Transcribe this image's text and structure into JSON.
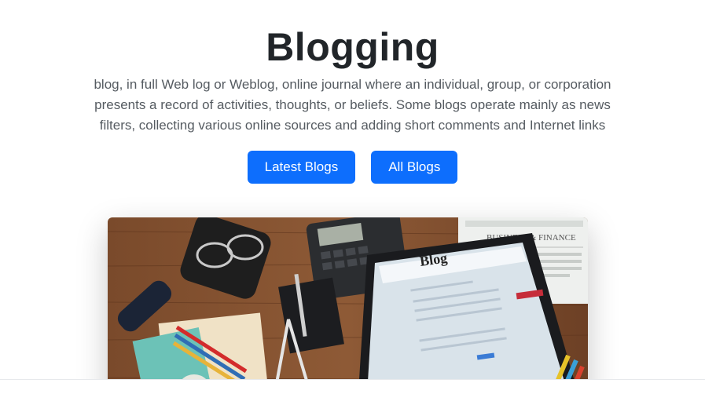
{
  "hero": {
    "title": "Blogging",
    "description": "blog, in full Web log or Weblog, online journal where an individual, group, or corporation presents a record of activities, thoughts, or beliefs. Some blogs operate mainly as news filters, collecting various online sources and adding short comments and Internet links",
    "buttons": {
      "latest": "Latest Blogs",
      "all": "All Blogs"
    }
  },
  "image": {
    "laptop_screen_heading": "Blog",
    "newspaper_heading": "BUSINESS & FINANCE"
  },
  "colors": {
    "primary": "#0d6efd",
    "title": "#212529",
    "text": "#555b61"
  }
}
